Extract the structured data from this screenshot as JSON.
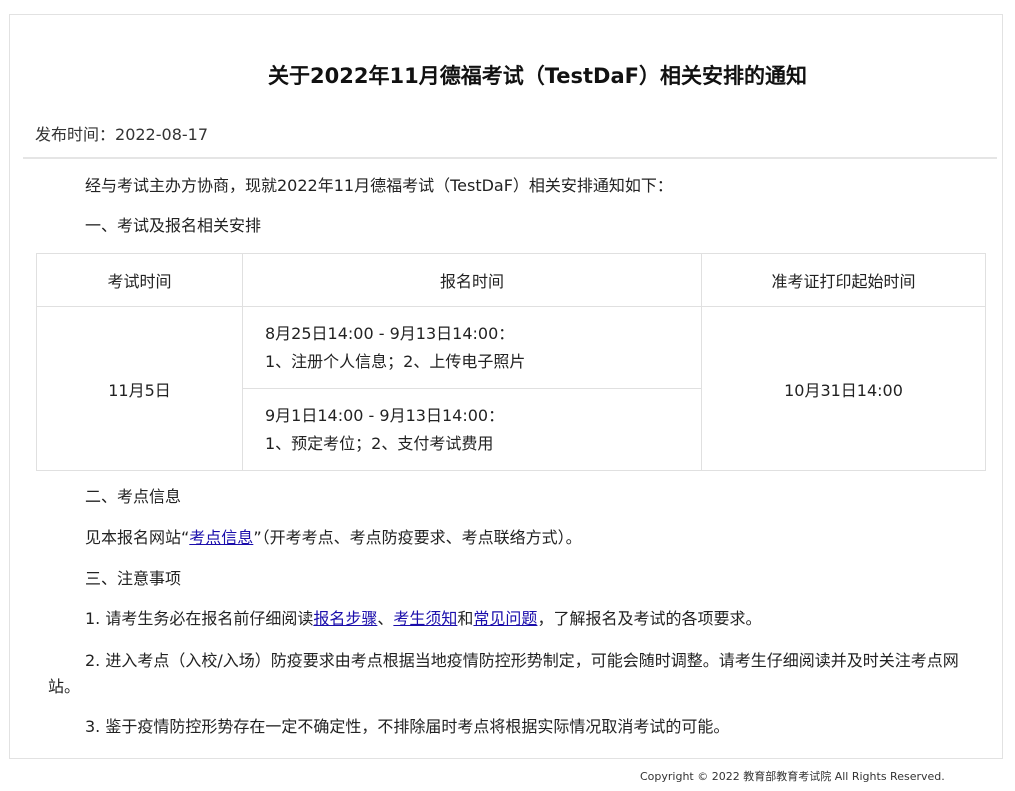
{
  "notice": {
    "title": "关于2022年11月德福考试（TestDaF）相关安排的通知",
    "pub_label": "发布时间：",
    "pub_date": "2022-08-17",
    "intro": "经与考试主办方协商，现就2022年11月德福考试（TestDaF）相关安排通知如下：",
    "section1": "一、考试及报名相关安排",
    "table": {
      "headers": [
        "考试时间",
        "报名时间",
        "准考证打印起始时间"
      ],
      "exam_date": "11月5日",
      "reg1_time": "8月25日14:00 - 9月13日14:00：",
      "reg1_steps": "1、注册个人信息；2、上传电子照片",
      "reg2_time": "9月1日14:00 - 9月13日14:00：",
      "reg2_steps": "1、预定考位；2、支付考试费用",
      "print_start": "10月31日14:00"
    },
    "section2": "二、考点信息",
    "venue": {
      "pre": "见本报名网站“",
      "link": "考点信息",
      "post": "”（开考考点、考点防疫要求、考点联络方式）。"
    },
    "section3": "三、注意事项",
    "note1": {
      "pre": "1. 请考生务必在报名前仔细阅读",
      "link1": "报名步骤",
      "sep1": "、",
      "link2": "考生须知",
      "sep2": "和",
      "link3": "常见问题",
      "post": "，了解报名及考试的各项要求。"
    },
    "note2": "2. 进入考点（入校/入场）防疫要求由考点根据当地疫情防控形势制定，可能会随时调整。请考生仔细阅读并及时关注考点网站。",
    "note3": "3. 鉴于疫情防控形势存在一定不确定性，不排除届时考点将根据实际情况取消考试的可能。"
  },
  "footer": {
    "copyright": "Copyright © 2022 教育部教育考试院 All Rights Reserved."
  }
}
